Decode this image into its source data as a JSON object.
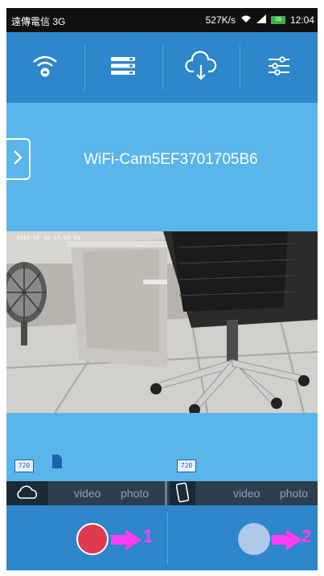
{
  "status_bar": {
    "carrier": "遠傳電信 3G",
    "speed": "527K/s",
    "battery": "28",
    "time": "12:04"
  },
  "toolbar": {
    "buttons": [
      {
        "icon": "wifi-icon"
      },
      {
        "icon": "list-icon"
      },
      {
        "icon": "cloud-download-icon"
      },
      {
        "icon": "settings-sliders-icon"
      }
    ]
  },
  "device": {
    "name": "WiFi-Cam5EF3701705B6"
  },
  "camera": {
    "timestamp": "2015-05-19 14:09:01"
  },
  "resolution_badges": [
    "720",
    "720"
  ],
  "mode_bar": {
    "left": {
      "video": "video",
      "photo": "photo"
    },
    "right": {
      "video": "video",
      "photo": "photo"
    }
  },
  "annotations": {
    "first": "1",
    "second": "2"
  },
  "colors": {
    "toolbar": "#2e86cb",
    "banner": "#5ab5ea",
    "mode_bar": "#2f3e4e",
    "record": "#e03a4e",
    "annotation": "#ff3df0"
  }
}
